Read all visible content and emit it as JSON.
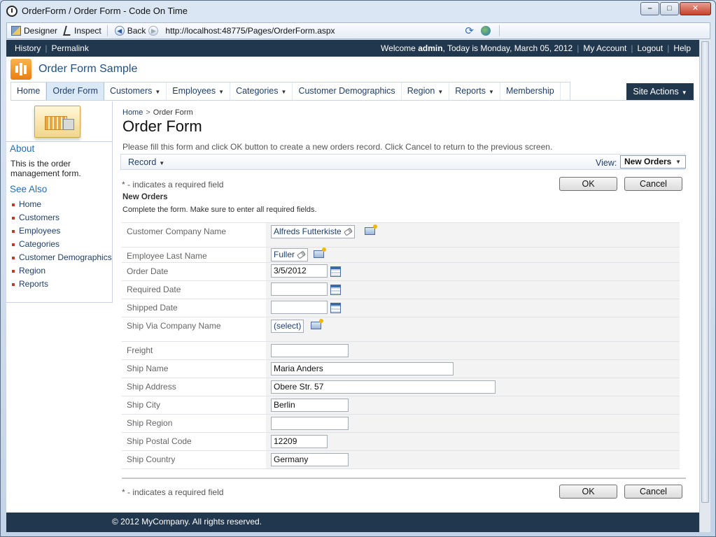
{
  "window": {
    "title": "OrderForm / Order Form - Code On Time",
    "buttons": {
      "minimize": "–",
      "maximize": "□",
      "close": "✕"
    }
  },
  "browser": {
    "designer": "Designer",
    "inspect": "Inspect",
    "back": "Back",
    "url": "http://localhost:48775/Pages/OrderForm.aspx"
  },
  "topbar": {
    "history": "History",
    "permalink": "Permalink",
    "welcome_prefix": "Welcome",
    "user": "admin",
    "date_text": ", Today is Monday, March 05, 2012",
    "my_account": "My Account",
    "logout": "Logout",
    "help": "Help"
  },
  "brand": {
    "title": "Order Form Sample"
  },
  "menu": {
    "items": [
      {
        "label": "Home",
        "dropdown": false
      },
      {
        "label": "Order Form",
        "dropdown": false,
        "active": true
      },
      {
        "label": "Customers",
        "dropdown": true
      },
      {
        "label": "Employees",
        "dropdown": true
      },
      {
        "label": "Categories",
        "dropdown": true
      },
      {
        "label": "Customer Demographics",
        "dropdown": false
      },
      {
        "label": "Region",
        "dropdown": true
      },
      {
        "label": "Reports",
        "dropdown": true
      },
      {
        "label": "Membership",
        "dropdown": false
      }
    ],
    "site_actions": "Site Actions"
  },
  "sidebar": {
    "about_title": "About",
    "about_text": "This is the order management form.",
    "see_also_title": "See Also",
    "links": [
      "Home",
      "Customers",
      "Employees",
      "Categories",
      "Customer Demographics",
      "Region",
      "Reports"
    ]
  },
  "breadcrumb": {
    "home": "Home",
    "current": "Order Form"
  },
  "page": {
    "title": "Order Form",
    "instructions": "Please fill this form and click OK button to create a new orders record. Click Cancel to return to the previous screen."
  },
  "actionbar": {
    "record": "Record",
    "view_label": "View:",
    "view_value": "New Orders"
  },
  "form": {
    "required_note": "* - indicates a required field",
    "ok": "OK",
    "cancel": "Cancel",
    "section_title": "New Orders",
    "section_desc": "Complete the form. Make sure to enter all required fields.",
    "fields": {
      "customer": {
        "label": "Customer Company Name",
        "value": "Alfreds Futterkiste"
      },
      "employee": {
        "label": "Employee Last Name",
        "value": "Fuller"
      },
      "order_date": {
        "label": "Order Date",
        "value": "3/5/2012"
      },
      "required_date": {
        "label": "Required Date",
        "value": ""
      },
      "shipped_date": {
        "label": "Shipped Date",
        "value": ""
      },
      "ship_via": {
        "label": "Ship Via Company Name",
        "value": "(select)"
      },
      "freight": {
        "label": "Freight",
        "value": ""
      },
      "ship_name": {
        "label": "Ship Name",
        "value": "Maria Anders"
      },
      "ship_address": {
        "label": "Ship Address",
        "value": "Obere Str. 57"
      },
      "ship_city": {
        "label": "Ship City",
        "value": "Berlin"
      },
      "ship_region": {
        "label": "Ship Region",
        "value": ""
      },
      "ship_postal": {
        "label": "Ship Postal Code",
        "value": "12209"
      },
      "ship_country": {
        "label": "Ship Country",
        "value": "Germany"
      }
    }
  },
  "footer": {
    "copyright": "© 2012 MyCompany. All rights reserved."
  }
}
